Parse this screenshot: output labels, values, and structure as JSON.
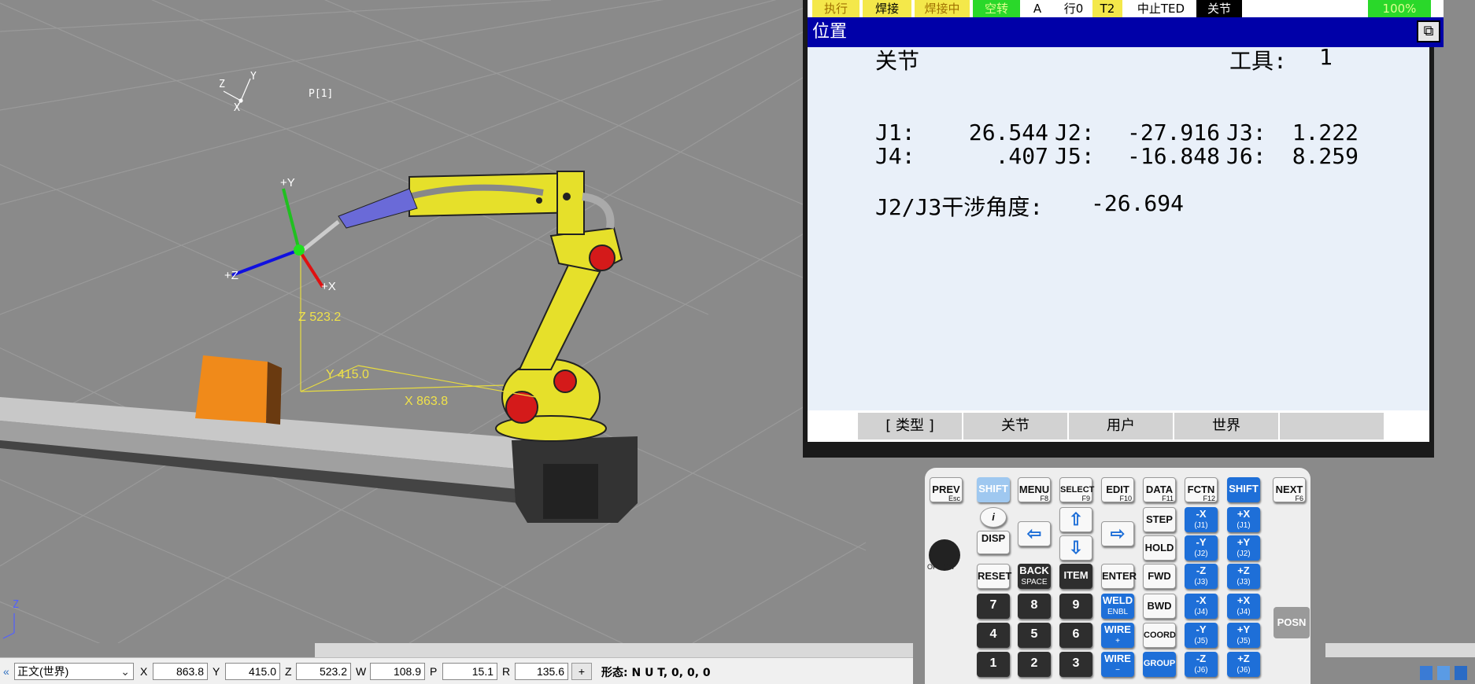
{
  "viewport": {
    "frame_label": "P[1]",
    "world_axes": {
      "z": "Z",
      "y": "Y",
      "x": "X"
    },
    "tool_axes": {
      "y": "+Y",
      "z": "+Z",
      "x": "+X"
    },
    "dimensions": {
      "z": "Z 523.2",
      "y": "Y 415.0",
      "x": "X 863.8"
    },
    "corner_axis": "Z"
  },
  "pendant": {
    "status_bar": [
      "执行",
      "焊接",
      "焊接中",
      "空转",
      "A",
      "行0",
      "T2",
      "中止TED",
      "关节",
      "100%"
    ],
    "title": "位置",
    "window_icon": "⧉",
    "mode_label": "关节",
    "tool_label": "工具:",
    "tool_value": "1",
    "joints": [
      {
        "name": "J1:",
        "value": "26.544"
      },
      {
        "name": "J2:",
        "value": "-27.916"
      },
      {
        "name": "J3:",
        "value": "1.222"
      },
      {
        "name": "J4:",
        "value": ".407"
      },
      {
        "name": "J5:",
        "value": "-16.848"
      },
      {
        "name": "J6:",
        "value": "8.259"
      }
    ],
    "interference_label": "J2/J3干涉角度:",
    "interference_value": "-26.694",
    "softkeys": [
      "[ 类型 ]",
      "关节",
      "用户",
      "世界",
      ""
    ]
  },
  "keypad": {
    "row1": [
      {
        "label": "PREV",
        "sub": "Esc"
      },
      {
        "label": "SHIFT",
        "sub": ""
      },
      {
        "label": "MENU",
        "sub": "F8"
      },
      {
        "label": "SELECT",
        "sub": "F9"
      },
      {
        "label": "EDIT",
        "sub": "F10"
      },
      {
        "label": "DATA",
        "sub": "F11"
      },
      {
        "label": "FCTN",
        "sub": "F12"
      },
      {
        "label": "SHIFT",
        "sub": ""
      },
      {
        "label": "NEXT",
        "sub": "F6"
      }
    ],
    "info": "i",
    "disp": "DISP",
    "arrows": {
      "left": "⇦",
      "up": "⇧",
      "down": "⇩",
      "right": "⇨"
    },
    "reset": "RESET",
    "backspace_top": "BACK",
    "backspace_bot": "SPACE",
    "item": "ITEM",
    "enter": "ENTER",
    "step": "STEP",
    "hold": "HOLD",
    "fwd": "FWD",
    "bwd": "BWD",
    "coord": "COORD",
    "group": "GROUP",
    "weld_top": "WELD",
    "weld_bot": "ENBL",
    "wire_plus_top": "WIRE",
    "wire_plus_bot": "+",
    "wire_minus_top": "WIRE",
    "wire_minus_bot": "−",
    "digits": [
      "7",
      "8",
      "9",
      "4",
      "5",
      "6",
      "1",
      "2",
      "3"
    ],
    "jog_minus": [
      {
        "top": "-X",
        "bot": "(J1)"
      },
      {
        "top": "-Y",
        "bot": "(J2)"
      },
      {
        "top": "-Z",
        "bot": "(J3)"
      },
      {
        "top": "-X",
        "bot": "(J4)"
      },
      {
        "top": "-Y",
        "bot": "(J5)"
      },
      {
        "top": "-Z",
        "bot": "(J6)"
      }
    ],
    "jog_plus": [
      {
        "top": "+X",
        "bot": "(J1)"
      },
      {
        "top": "+Y",
        "bot": "(J2)"
      },
      {
        "top": "+Z",
        "bot": "(J3)"
      },
      {
        "top": "+X",
        "bot": "(J4)"
      },
      {
        "top": "+Y",
        "bot": "(J5)"
      },
      {
        "top": "+Z",
        "bot": "(J6)"
      }
    ],
    "posn": "POSN",
    "power_label": "OFF  ON"
  },
  "statusbar": {
    "view_mode": "正文(世界)",
    "x_label": "X",
    "x_value": "863.8",
    "y_label": "Y",
    "y_value": "415.0",
    "z_label": "Z",
    "z_value": "523.2",
    "w_label": "W",
    "w_value": "108.9",
    "p_label": "P",
    "p_value": "15.1",
    "r_label": "R",
    "r_value": "135.6",
    "plus": "+",
    "shape": "形态: N U T, 0, 0, 0"
  },
  "colors": {
    "robot": "#e6e02a",
    "motor": "#d41a1a",
    "pendant_title": "#0000a8",
    "pendant_body": "#e9f0f9",
    "jog_key": "#1e6fd8",
    "part": "#f08a1a"
  }
}
